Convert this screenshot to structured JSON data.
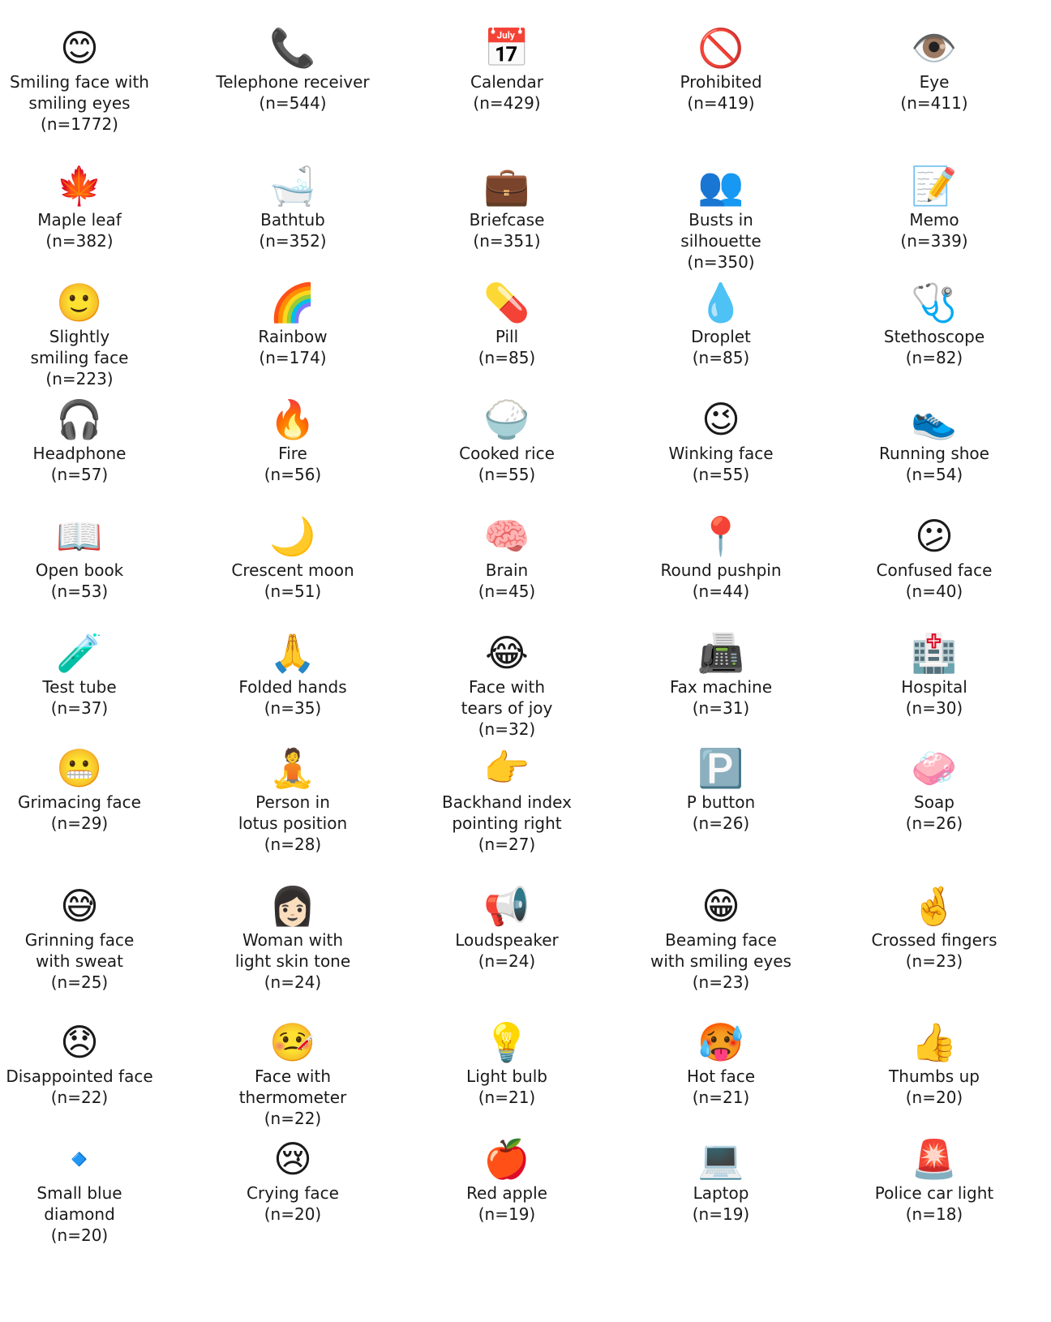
{
  "items": [
    {
      "icon": "smiling-face-with-smiling-eyes-icon",
      "emoji": "😊",
      "label": "Smiling face with\nsmiling eyes",
      "count": "(n=1772)"
    },
    {
      "icon": "telephone-receiver-icon",
      "emoji": "📞",
      "label": "Telephone receiver",
      "count": "(n=544)"
    },
    {
      "icon": "calendar-icon",
      "emoji": "📅",
      "label": "Calendar",
      "count": "(n=429)"
    },
    {
      "icon": "prohibited-icon",
      "emoji": "🚫",
      "label": "Prohibited",
      "count": "(n=419)"
    },
    {
      "icon": "eye-icon",
      "emoji": "👁️",
      "label": "Eye",
      "count": "(n=411)"
    },
    {
      "icon": "maple-leaf-icon",
      "emoji": "🍁",
      "label": "Maple leaf",
      "count": "(n=382)"
    },
    {
      "icon": "bathtub-icon",
      "emoji": "🛁",
      "label": "Bathtub",
      "count": "(n=352)"
    },
    {
      "icon": "briefcase-icon",
      "emoji": "💼",
      "label": "Briefcase",
      "count": "(n=351)"
    },
    {
      "icon": "busts-in-silhouette-icon",
      "emoji": "👥",
      "label": "Busts in\nsilhouette",
      "count": "(n=350)"
    },
    {
      "icon": "memo-icon",
      "emoji": "📝",
      "label": "Memo",
      "count": "(n=339)"
    },
    {
      "icon": "slightly-smiling-face-icon",
      "emoji": "🙂",
      "label": "Slightly\nsmiling face",
      "count": "(n=223)"
    },
    {
      "icon": "rainbow-icon",
      "emoji": "🌈",
      "label": "Rainbow",
      "count": "(n=174)"
    },
    {
      "icon": "pill-icon",
      "emoji": "💊",
      "label": "Pill",
      "count": "(n=85)"
    },
    {
      "icon": "droplet-icon",
      "emoji": "💧",
      "label": "Droplet",
      "count": "(n=85)"
    },
    {
      "icon": "stethoscope-icon",
      "emoji": "🩺",
      "label": "Stethoscope",
      "count": "(n=82)"
    },
    {
      "icon": "headphone-icon",
      "emoji": "🎧",
      "label": "Headphone",
      "count": "(n=57)"
    },
    {
      "icon": "fire-icon",
      "emoji": "🔥",
      "label": "Fire",
      "count": "(n=56)"
    },
    {
      "icon": "cooked-rice-icon",
      "emoji": "🍚",
      "label": "Cooked rice",
      "count": "(n=55)"
    },
    {
      "icon": "winking-face-icon",
      "emoji": "😉",
      "label": "Winking face",
      "count": "(n=55)"
    },
    {
      "icon": "running-shoe-icon",
      "emoji": "👟",
      "label": "Running shoe",
      "count": "(n=54)"
    },
    {
      "icon": "open-book-icon",
      "emoji": "📖",
      "label": "Open book",
      "count": "(n=53)"
    },
    {
      "icon": "crescent-moon-icon",
      "emoji": "🌙",
      "label": "Crescent moon",
      "count": "(n=51)"
    },
    {
      "icon": "brain-icon",
      "emoji": "🧠",
      "label": "Brain",
      "count": "(n=45)"
    },
    {
      "icon": "round-pushpin-icon",
      "emoji": "📍",
      "label": "Round pushpin",
      "count": "(n=44)"
    },
    {
      "icon": "confused-face-icon",
      "emoji": "😕",
      "label": "Confused face",
      "count": "(n=40)"
    },
    {
      "icon": "test-tube-icon",
      "emoji": "🧪",
      "label": "Test tube",
      "count": "(n=37)"
    },
    {
      "icon": "folded-hands-icon",
      "emoji": "🙏",
      "label": "Folded hands",
      "count": "(n=35)"
    },
    {
      "icon": "face-with-tears-of-joy-icon",
      "emoji": "😂",
      "label": "Face with\ntears of joy",
      "count": "(n=32)"
    },
    {
      "icon": "fax-machine-icon",
      "emoji": "📠",
      "label": "Fax machine",
      "count": "(n=31)"
    },
    {
      "icon": "hospital-icon",
      "emoji": "🏥",
      "label": "Hospital",
      "count": "(n=30)"
    },
    {
      "icon": "grimacing-face-icon",
      "emoji": "😬",
      "label": "Grimacing face",
      "count": "(n=29)"
    },
    {
      "icon": "person-in-lotus-position-icon",
      "emoji": "🧘",
      "label": "Person in\nlotus position",
      "count": "(n=28)"
    },
    {
      "icon": "backhand-index-pointing-right-icon",
      "emoji": "👉",
      "label": "Backhand index\npointing right",
      "count": "(n=27)"
    },
    {
      "icon": "p-button-icon",
      "emoji": "🅿️",
      "label": "P button",
      "count": "(n=26)"
    },
    {
      "icon": "soap-icon",
      "emoji": "🧼",
      "label": "Soap",
      "count": "(n=26)"
    },
    {
      "icon": "grinning-face-with-sweat-icon",
      "emoji": "😅",
      "label": "Grinning face\nwith sweat",
      "count": "(n=25)"
    },
    {
      "icon": "woman-light-skin-tone-icon",
      "emoji": "👩🏻",
      "label": "Woman with\nlight skin tone",
      "count": "(n=24)"
    },
    {
      "icon": "loudspeaker-icon",
      "emoji": "📢",
      "label": "Loudspeaker",
      "count": "(n=24)"
    },
    {
      "icon": "beaming-face-with-smiling-eyes-icon",
      "emoji": "😁",
      "label": "Beaming face\nwith smiling eyes",
      "count": "(n=23)"
    },
    {
      "icon": "crossed-fingers-icon",
      "emoji": "🤞",
      "label": "Crossed fingers",
      "count": "(n=23)"
    },
    {
      "icon": "disappointed-face-icon",
      "emoji": "😞",
      "label": "Disappointed face",
      "count": "(n=22)"
    },
    {
      "icon": "face-with-thermometer-icon",
      "emoji": "🤒",
      "label": "Face with\nthermometer",
      "count": "(n=22)"
    },
    {
      "icon": "light-bulb-icon",
      "emoji": "💡",
      "label": "Light bulb",
      "count": "(n=21)"
    },
    {
      "icon": "hot-face-icon",
      "emoji": "🥵",
      "label": "Hot face",
      "count": "(n=21)"
    },
    {
      "icon": "thumbs-up-icon",
      "emoji": "👍",
      "label": "Thumbs up",
      "count": "(n=20)"
    },
    {
      "icon": "small-blue-diamond-icon",
      "emoji": "🔹",
      "label": "Small blue\ndiamond",
      "count": "(n=20)"
    },
    {
      "icon": "crying-face-icon",
      "emoji": "😢",
      "label": "Crying face",
      "count": "(n=20)"
    },
    {
      "icon": "red-apple-icon",
      "emoji": "🍎",
      "label": "Red apple",
      "count": "(n=19)"
    },
    {
      "icon": "laptop-icon",
      "emoji": "💻",
      "label": "Laptop",
      "count": "(n=19)"
    },
    {
      "icon": "police-car-light-icon",
      "emoji": "🚨",
      "label": "Police car light",
      "count": "(n=18)"
    }
  ]
}
